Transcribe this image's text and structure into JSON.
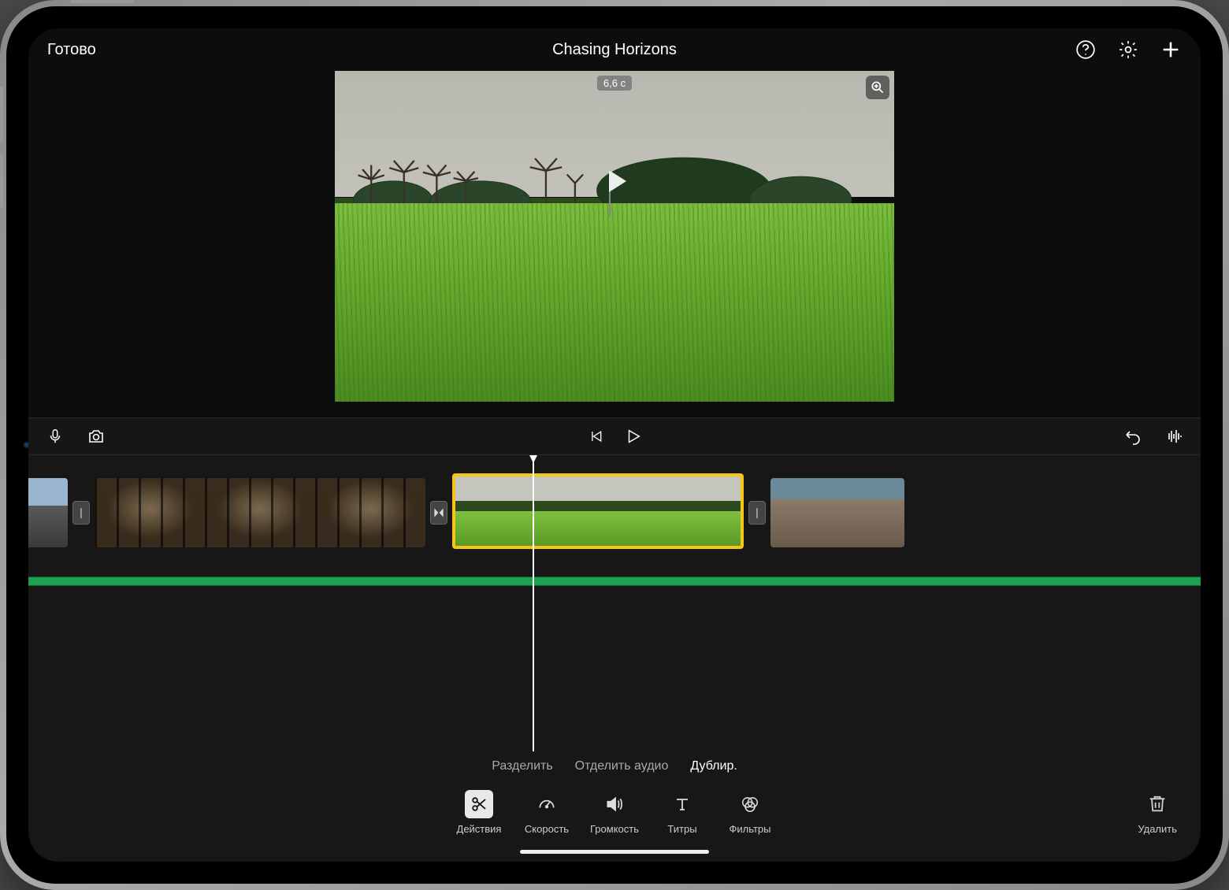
{
  "header": {
    "done": "Готово",
    "title": "Chasing Horizons"
  },
  "preview": {
    "duration_badge": "6,6 с"
  },
  "actions": {
    "split": "Разделить",
    "detach_audio": "Отделить аудио",
    "duplicate": "Дублир."
  },
  "toolbar": {
    "items": [
      {
        "key": "actions",
        "label": "Действия"
      },
      {
        "key": "speed",
        "label": "Скорость"
      },
      {
        "key": "volume",
        "label": "Громкость"
      },
      {
        "key": "titles",
        "label": "Титры"
      },
      {
        "key": "filters",
        "label": "Фильтры"
      }
    ],
    "delete": "Удалить"
  }
}
